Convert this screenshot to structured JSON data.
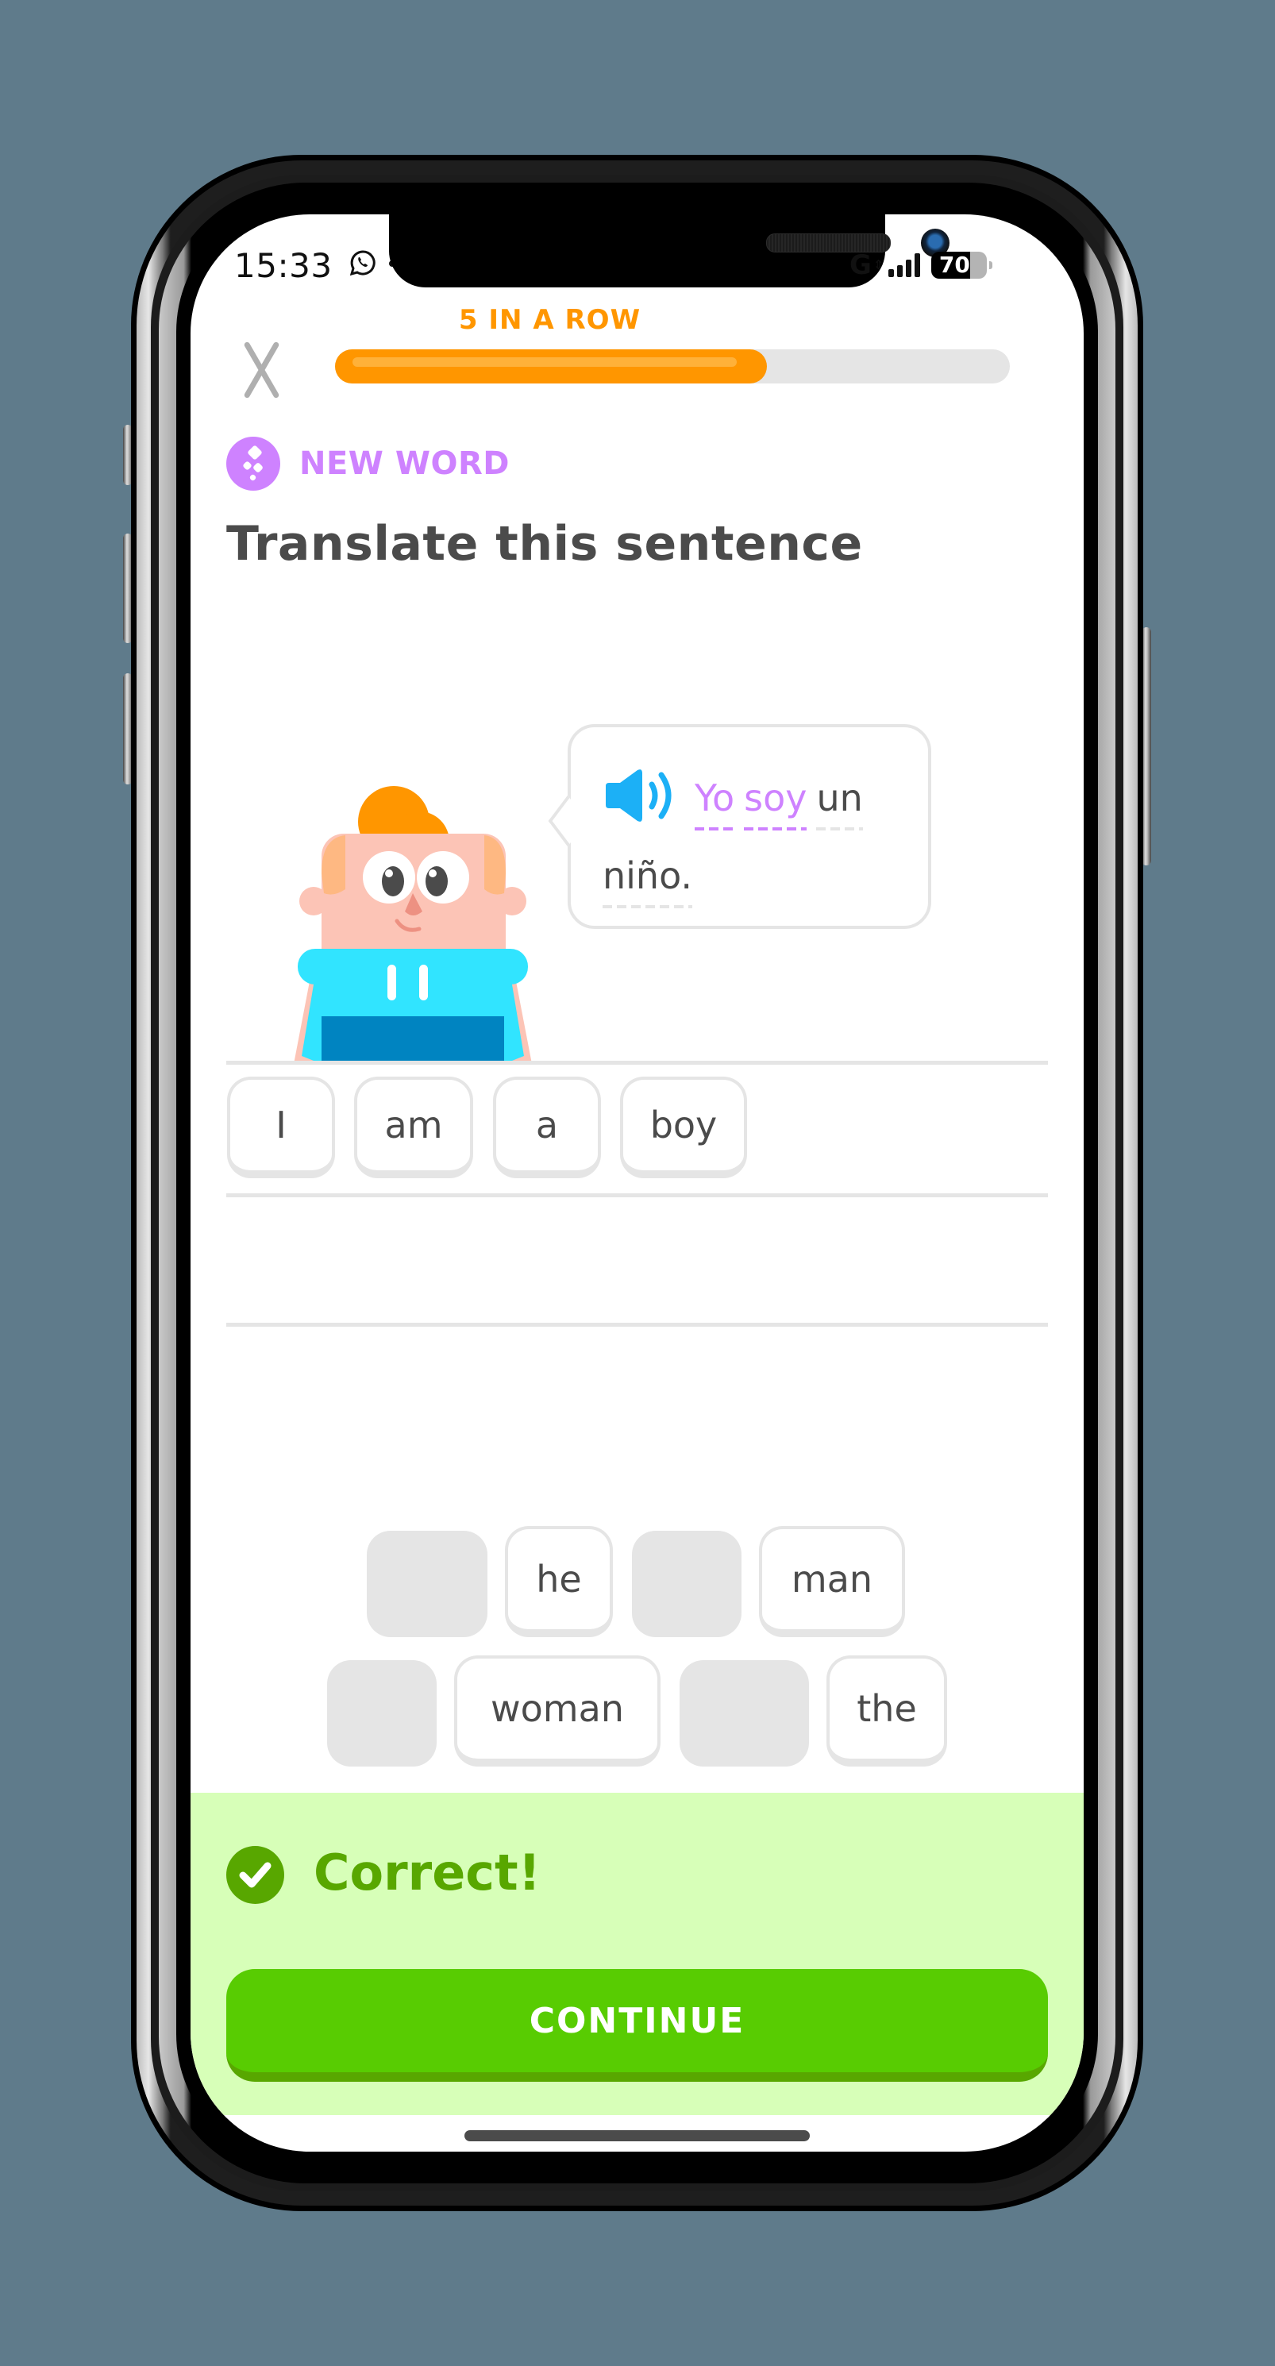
{
  "status_bar": {
    "time": "15:33",
    "network": "G",
    "battery": "70"
  },
  "header": {
    "streak_label": "5 IN A ROW",
    "progress": 0.64,
    "close_label": "Close"
  },
  "challenge": {
    "tag": "NEW WORD",
    "title": "Translate this sentence",
    "prompt_words": [
      {
        "text": "Yo",
        "new": true
      },
      {
        "text": "soy",
        "new": true
      },
      {
        "text": "un",
        "new": false
      },
      {
        "text": "niño.",
        "new": false
      }
    ]
  },
  "answer": {
    "selected_words": [
      "I",
      "am",
      "a",
      "boy"
    ]
  },
  "word_bank": {
    "row1": [
      {
        "text": "",
        "used": true
      },
      {
        "text": "he",
        "used": false
      },
      {
        "text": "",
        "used": true
      },
      {
        "text": "man",
        "used": false
      }
    ],
    "row2": [
      {
        "text": "",
        "used": true
      },
      {
        "text": "woman",
        "used": false
      },
      {
        "text": "",
        "used": true
      },
      {
        "text": "the",
        "used": false
      }
    ]
  },
  "feedback": {
    "message": "Correct!",
    "continue_label": "CONTINUE"
  },
  "colors": {
    "streak": "#ff9600",
    "new_word": "#ce82ff",
    "correct": "#58a700",
    "button": "#58cc02",
    "feedback_bg": "#d7ffb8",
    "speaker": "#1cb0f6"
  }
}
